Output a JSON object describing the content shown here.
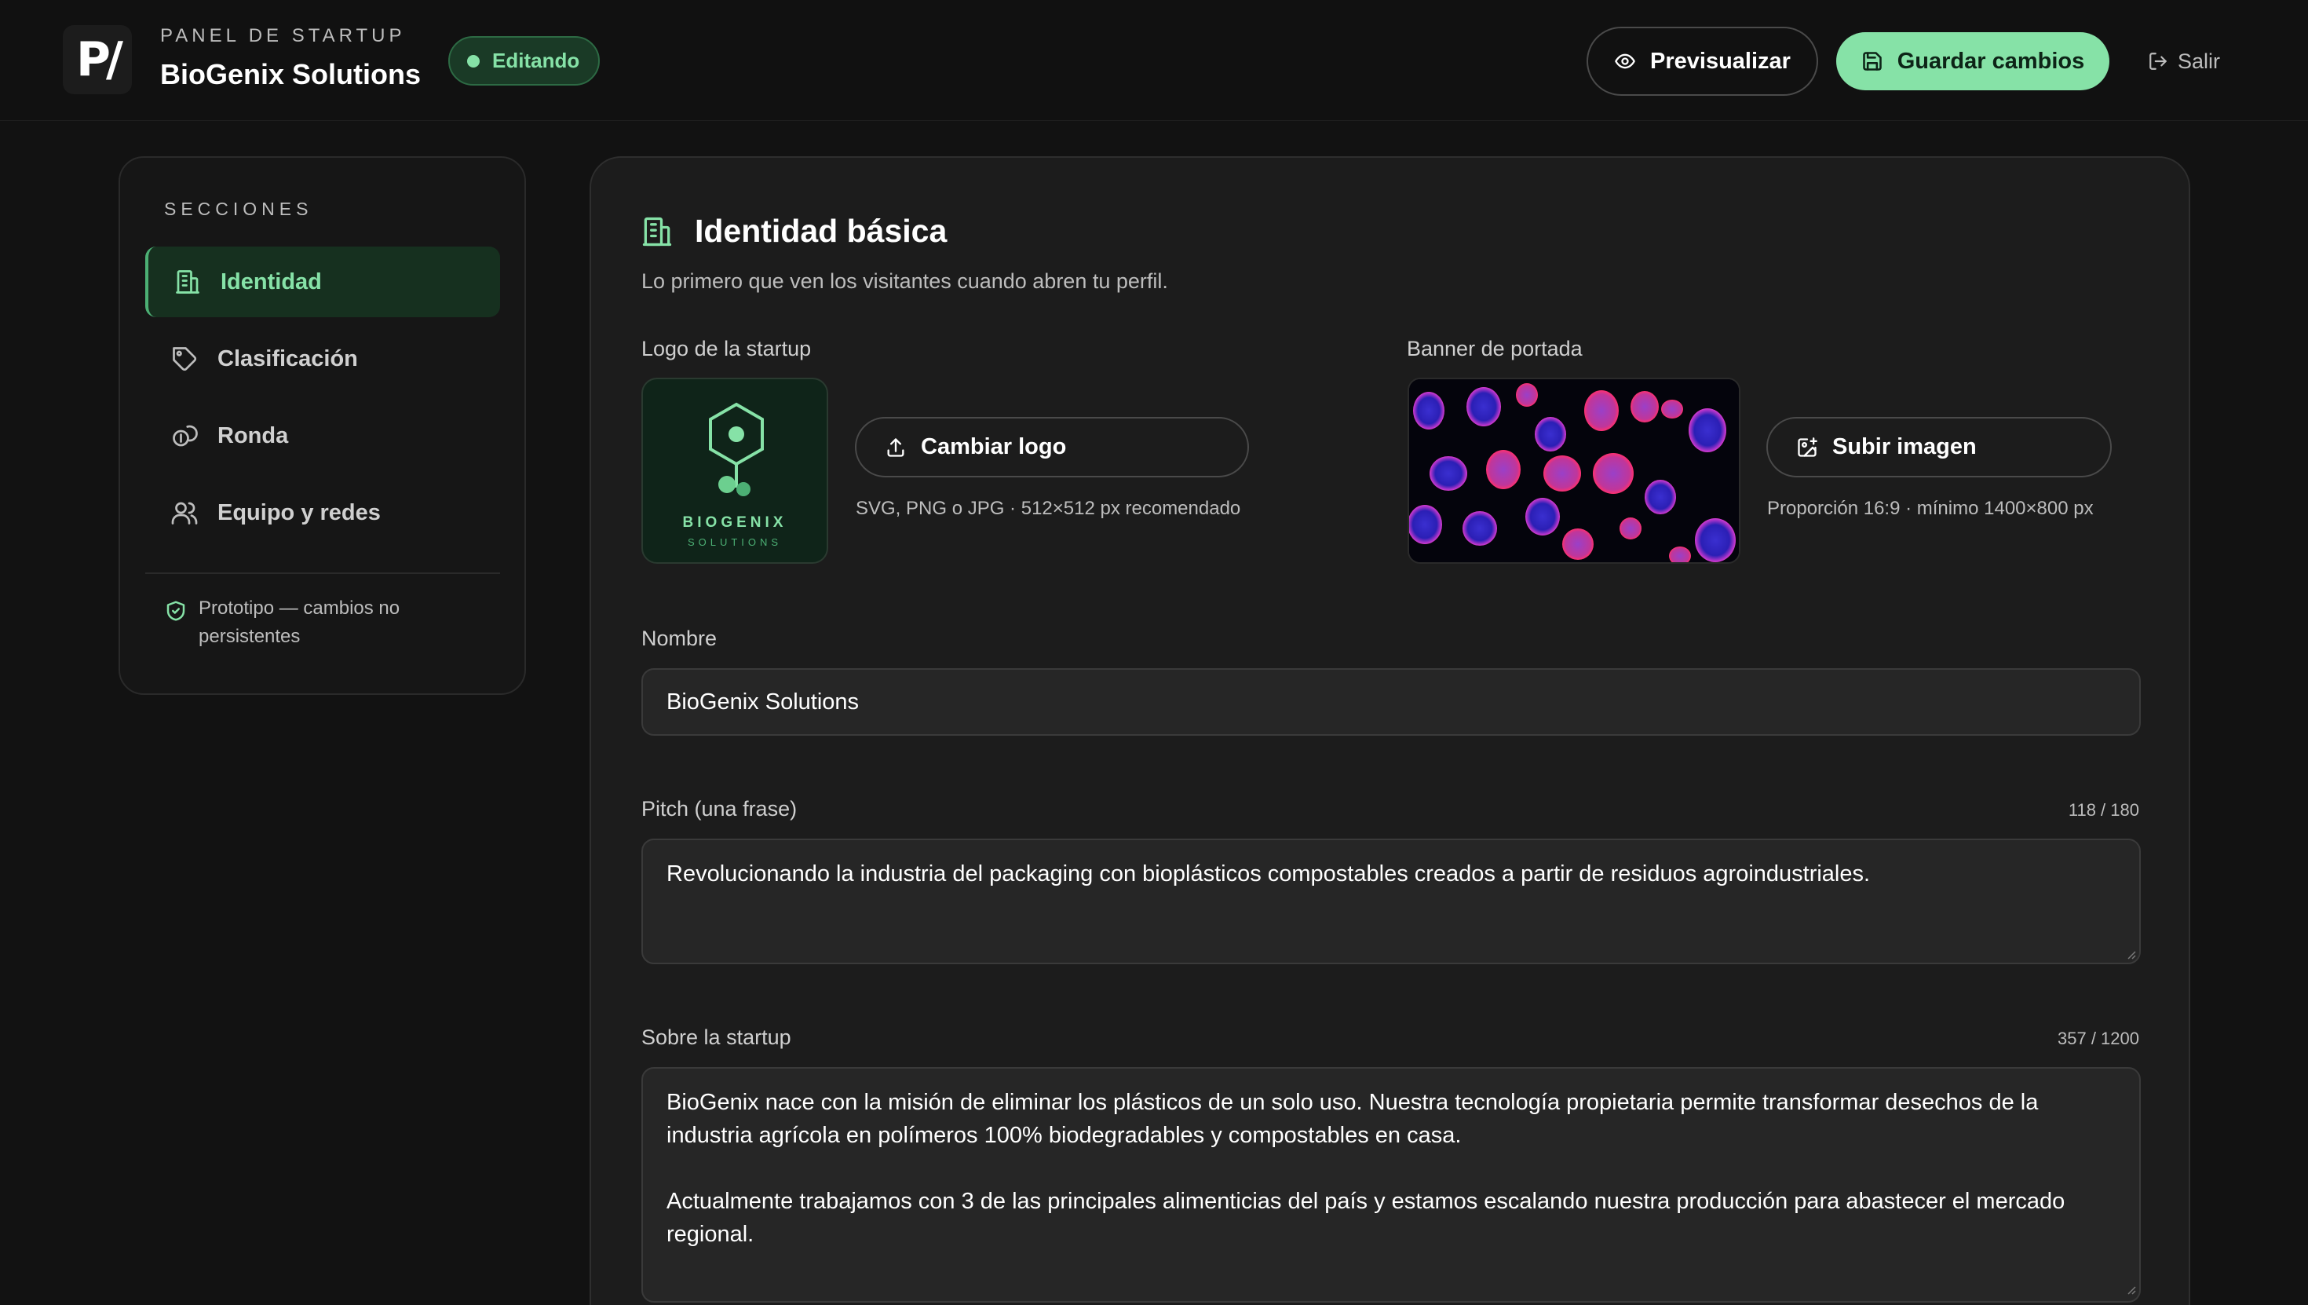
{
  "header": {
    "logo_text": "P/",
    "eyebrow": "PANEL DE STARTUP",
    "company_name": "BioGenix Solutions",
    "status_badge": "Editando",
    "preview_label": "Previsualizar",
    "save_label": "Guardar cambios",
    "exit_label": "Salir"
  },
  "sidebar": {
    "title": "SECCIONES",
    "items": [
      {
        "label": "Identidad",
        "icon": "building-icon",
        "active": true
      },
      {
        "label": "Clasificación",
        "icon": "tag-icon",
        "active": false
      },
      {
        "label": "Ronda",
        "icon": "coins-icon",
        "active": false
      },
      {
        "label": "Equipo y redes",
        "icon": "users-icon",
        "active": false
      }
    ],
    "note": "Prototipo — cambios no persistentes"
  },
  "main": {
    "section_title": "Identidad básica",
    "section_subtitle": "Lo primero que ven los visitantes cuando abren tu perfil.",
    "logo": {
      "label": "Logo de la startup",
      "wordmark": "BIOGENIX",
      "wordmark_sub": "SOLUTIONS",
      "button": "Cambiar logo",
      "hint": "SVG, PNG o JPG · 512×512 px recomendado"
    },
    "banner": {
      "label": "Banner de portada",
      "button": "Subir imagen",
      "hint": "Proporción 16:9 · mínimo 1400×800 px"
    },
    "name": {
      "label": "Nombre",
      "value": "BioGenix Solutions"
    },
    "pitch": {
      "label": "Pitch (una frase)",
      "counter": "118 / 180",
      "value": "Revolucionando la industria del packaging con bioplásticos compostables creados a partir de residuos agroindustriales."
    },
    "about": {
      "label": "Sobre la startup",
      "counter": "357 / 1200",
      "value": "BioGenix nace con la misión de eliminar los plásticos de un solo uso. Nuestra tecnología propietaria permite transformar desechos de la industria agrícola en polímeros 100% biodegradables y compostables en casa.\n\nActualmente trabajamos con 3 de las principales alimenticias del país y estamos escalando nuestra producción para abastecer el mercado regional."
    }
  },
  "colors": {
    "accent": "#86e2a7",
    "background": "#121212",
    "panel": "#1c1c1c"
  }
}
